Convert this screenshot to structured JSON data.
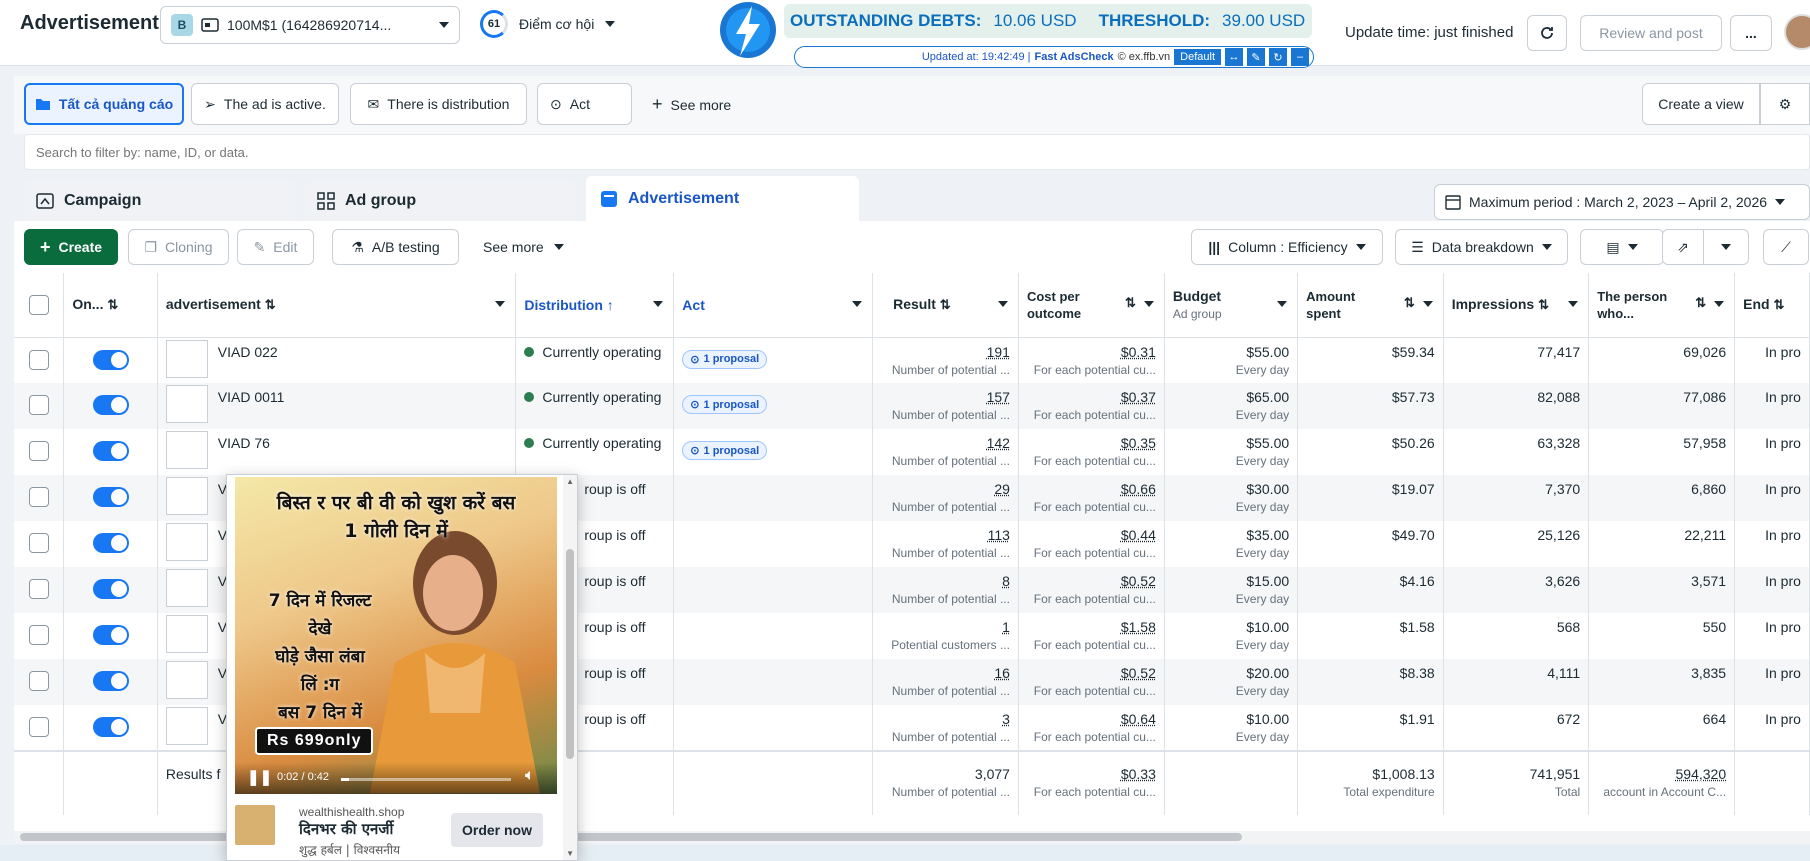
{
  "header": {
    "title": "Advertisement",
    "account_badge": "B",
    "account_name": "100M$1 (164286920714...",
    "score_value": "61",
    "score_label": "Điểm cơ hội",
    "update_time": "Update time: just finished",
    "review_button": "Review and post",
    "more_button": "..."
  },
  "adscheck": {
    "debts_label": "OUTSTANDING DEBTS:",
    "debts_value": "10.06 USD",
    "threshold_label": "THRESHOLD:",
    "threshold_value": "39.00 USD",
    "updated_text": "Updated at: 19:42:49 |",
    "brand": "Fast AdsCheck",
    "copyright": "© ex.ffb.vn",
    "profile_select": "Default"
  },
  "filters": {
    "tabs": [
      "Tất cả quảng cáo",
      "The ad is active.",
      "There is distribution",
      "Act"
    ],
    "see_more": "See more",
    "create_view": "Create a view",
    "search_placeholder": "Search to filter by: name, ID, or data."
  },
  "level_tabs": {
    "campaign": "Campaign",
    "ad_group": "Ad group",
    "advertisement": "Advertisement",
    "date_range": "Maximum period : March 2, 2023 – April 2, 2026"
  },
  "toolbar": {
    "create": "Create",
    "cloning": "Cloning",
    "edit": "Edit",
    "ab_testing": "A/B testing",
    "see_more": "See more",
    "column": "Column : Efficiency",
    "breakdown": "Data breakdown"
  },
  "table": {
    "headers": {
      "on": "On...",
      "ad": "advertisement",
      "distribution": "Distribution",
      "act": "Act",
      "result": "Result",
      "cpo": "Cost per outcome",
      "budget": "Budget",
      "budget_sub": "Ad group",
      "spent": "Amount spent",
      "impressions": "Impressions",
      "person": "The person who...",
      "end": "End"
    },
    "rows": [
      {
        "name": "VIAD 022",
        "dist": "Currently operating",
        "act": "1 proposal",
        "result": "191",
        "result_sub": "Number of potential ...",
        "cpo": "$0.31",
        "cpo_sub": "For each potential cu...",
        "budget": "$55.00",
        "budget_sub": "Every day",
        "spent": "$59.34",
        "impr": "77,417",
        "person": "69,026",
        "end": "In pro"
      },
      {
        "name": "VIAD 0011",
        "dist": "Currently operating",
        "act": "1 proposal",
        "result": "157",
        "result_sub": "Number of potential ...",
        "cpo": "$0.37",
        "cpo_sub": "For each potential cu...",
        "budget": "$65.00",
        "budget_sub": "Every day",
        "spent": "$57.73",
        "impr": "82,088",
        "person": "77,086",
        "end": "In pro"
      },
      {
        "name": "VIAD 76",
        "dist": "Currently operating",
        "act": "1 proposal",
        "result": "142",
        "result_sub": "Number of potential ...",
        "cpo": "$0.35",
        "cpo_sub": "For each potential cu...",
        "budget": "$55.00",
        "budget_sub": "Every day",
        "spent": "$50.26",
        "impr": "63,328",
        "person": "57,958",
        "end": "In pro"
      },
      {
        "name": "V",
        "dist": "roup is off",
        "act": "",
        "result": "29",
        "result_sub": "Number of potential ...",
        "cpo": "$0.66",
        "cpo_sub": "For each potential cu...",
        "budget": "$30.00",
        "budget_sub": "Every day",
        "spent": "$19.07",
        "impr": "7,370",
        "person": "6,860",
        "end": "In pro"
      },
      {
        "name": "V",
        "dist": "roup is off",
        "act": "",
        "result": "113",
        "result_sub": "Number of potential ...",
        "cpo": "$0.44",
        "cpo_sub": "For each potential cu...",
        "budget": "$35.00",
        "budget_sub": "Every day",
        "spent": "$49.70",
        "impr": "25,126",
        "person": "22,211",
        "end": "In pro"
      },
      {
        "name": "V",
        "dist": "roup is off",
        "act": "",
        "result": "8",
        "result_sub": "Number of potential ...",
        "cpo": "$0.52",
        "cpo_sub": "For each potential cu...",
        "budget": "$15.00",
        "budget_sub": "Every day",
        "spent": "$4.16",
        "impr": "3,626",
        "person": "3,571",
        "end": "In pro"
      },
      {
        "name": "V",
        "dist": "roup is off",
        "act": "",
        "result": "1",
        "result_sub": "Potential customers ...",
        "cpo": "$1.58",
        "cpo_sub": "For each potential cu...",
        "budget": "$10.00",
        "budget_sub": "Every day",
        "spent": "$1.58",
        "impr": "568",
        "person": "550",
        "end": "In pro"
      },
      {
        "name": "V",
        "dist": "roup is off",
        "act": "",
        "result": "16",
        "result_sub": "Number of potential ...",
        "cpo": "$0.52",
        "cpo_sub": "For each potential cu...",
        "budget": "$20.00",
        "budget_sub": "Every day",
        "spent": "$8.38",
        "impr": "4,111",
        "person": "3,835",
        "end": "In pro"
      },
      {
        "name": "V",
        "dist": "roup is off",
        "act": "",
        "result": "3",
        "result_sub": "Number of potential ...",
        "cpo": "$0.64",
        "cpo_sub": "For each potential cu...",
        "budget": "$10.00",
        "budget_sub": "Every day",
        "spent": "$1.91",
        "impr": "672",
        "person": "664",
        "end": "In pro"
      }
    ],
    "totals": {
      "label": "Results f",
      "result": "3,077",
      "result_sub": "Number of potential ...",
      "cpo": "$0.33",
      "cpo_sub": "For each potential cu...",
      "spent": "$1,008.13",
      "spent_sub": "Total expenditure",
      "impr": "741,951",
      "impr_sub": "Total",
      "person": "594,320",
      "person_sub": "account in Account C..."
    }
  },
  "preview": {
    "headline_1": "बिस्त र पर बी वी को खुश करें बस",
    "headline_2": "1 गोली दिन में",
    "line_1": "7 दिन में रिजल्ट",
    "line_2": "देखे",
    "line_3": "घोड़े जैसा लंबा",
    "line_4": "लिं :ग",
    "line_5": "बस 7 दिन में",
    "price": "Rs 699only",
    "time": "0:02 / 0:42",
    "domain": "wealthishealth.shop",
    "title": "दिनभर की एनर्जी",
    "subtitle": "शुद्ध हर्बल | विश्वसनीय",
    "cta": "Order now"
  }
}
